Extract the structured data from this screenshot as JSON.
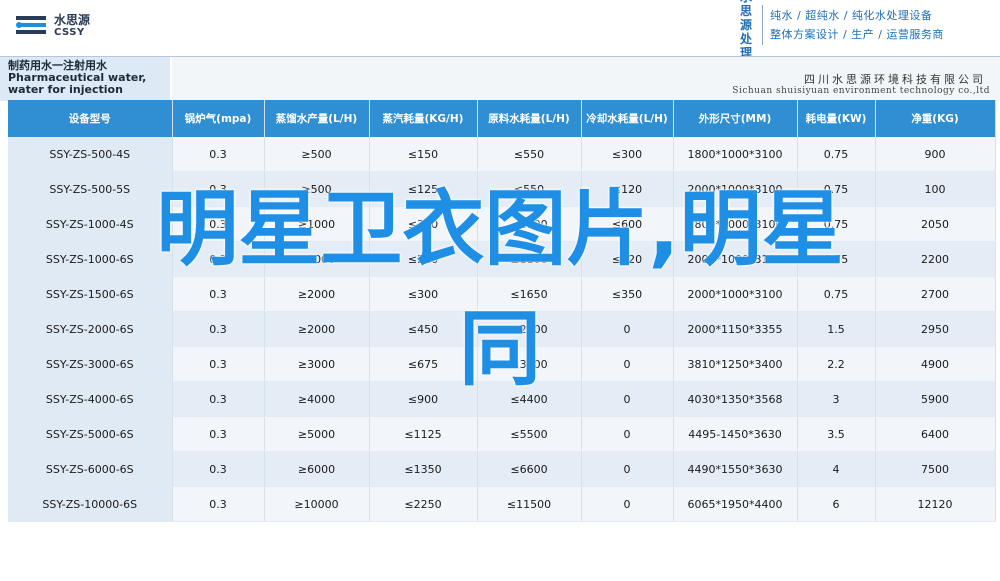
{
  "header": {
    "logo_cn": "水思源",
    "logo_en": "CSSY",
    "brand_side": "水思源处理",
    "brand_line1": "纯水 / 超纯水 / 纯化水处理设备",
    "brand_line2": "整体方案设计 / 生产 / 运营服务商"
  },
  "title": {
    "product_name": "制药用水一注射用水 Pharmaceutical water, water for injection",
    "company_cn": "四川水思源环境科技有限公司",
    "company_en": "Sichuan shuisiyuan environment technology co.,ltd"
  },
  "table": {
    "headers": [
      "设备型号",
      "锅炉气(mpa)",
      "蒸馏水产量(L/H)",
      "蒸汽耗量(KG/H)",
      "原料水耗量(L/H)",
      "冷却水耗量(L/H)",
      "外形尺寸(MM)",
      "耗电量(KW)",
      "净重(KG)"
    ],
    "rows": [
      [
        "SSY-ZS-500-4S",
        "0.3",
        "≥500",
        "≤150",
        "≤550",
        "≤300",
        "1800*1000*3100",
        "0.75",
        "900"
      ],
      [
        "SSY-ZS-500-5S",
        "0.3",
        "≥500",
        "≤125",
        "≤550",
        "≤120",
        "2000*1000*3100",
        "0.75",
        "100"
      ],
      [
        "SSY-ZS-1000-4S",
        "0.3",
        "≥1000",
        "≤300",
        "≤1100",
        "≤600",
        "1800*1000*3100",
        "0.75",
        "2050"
      ],
      [
        "SSY-ZS-1000-6S",
        "0.3",
        "≥1000",
        "≤220",
        "≤1100",
        "≤220",
        "2000*1000*3100",
        "0.75",
        "2200"
      ],
      [
        "SSY-ZS-1500-6S",
        "0.3",
        "≥2000",
        "≤300",
        "≤1650",
        "≤350",
        "2000*1000*3100",
        "0.75",
        "2700"
      ],
      [
        "SSY-ZS-2000-6S",
        "0.3",
        "≥2000",
        "≤450",
        "≤2200",
        "0",
        "2000*1150*3355",
        "1.5",
        "2950"
      ],
      [
        "SSY-ZS-3000-6S",
        "0.3",
        "≥3000",
        "≤675",
        "≤3300",
        "0",
        "3810*1250*3400",
        "2.2",
        "4900"
      ],
      [
        "SSY-ZS-4000-6S",
        "0.3",
        "≥4000",
        "≤900",
        "≤4400",
        "0",
        "4030*1350*3568",
        "3",
        "5900"
      ],
      [
        "SSY-ZS-5000-6S",
        "0.3",
        "≥5000",
        "≤1125",
        "≤5500",
        "0",
        "4495-1450*3630",
        "3.5",
        "6400"
      ],
      [
        "SSY-ZS-6000-6S",
        "0.3",
        "≥6000",
        "≤1350",
        "≤6600",
        "0",
        "4490*1550*3630",
        "4",
        "7500"
      ],
      [
        "SSY-ZS-10000-6S",
        "0.3",
        "≥10000",
        "≤2250",
        "≤11500",
        "0",
        "6065*1950*4400",
        "6",
        "12120"
      ]
    ]
  },
  "overlay": {
    "line1": "明星卫衣图片,明星",
    "line2": "同"
  },
  "colors": {
    "header_blue": "#2f8fd2",
    "overlay_blue": "#1f8fe6",
    "brand_blue": "#1e6fb8"
  }
}
